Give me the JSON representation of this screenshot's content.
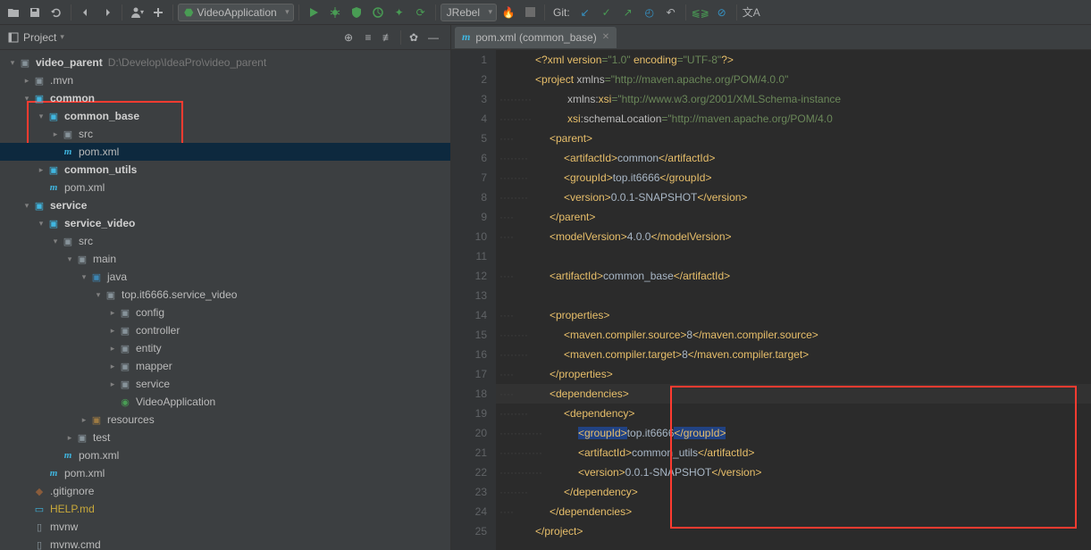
{
  "toolbar": {
    "run_config": "VideoApplication",
    "jrebel": "JRebel",
    "git_label": "Git:"
  },
  "sidebar": {
    "title": "Project",
    "root": {
      "name": "video_parent",
      "path": "D:\\Develop\\IdeaPro\\video_parent"
    },
    "items": {
      "mvn": ".mvn",
      "common": "common",
      "common_base": "common_base",
      "src1": "src",
      "pom1": "pom.xml",
      "common_utils": "common_utils",
      "pom2": "pom.xml",
      "service": "service",
      "service_video": "service_video",
      "src2": "src",
      "main": "main",
      "java": "java",
      "pkg": "top.it6666.service_video",
      "config": "config",
      "controller": "controller",
      "entity": "entity",
      "mapper": "mapper",
      "service_pkg": "service",
      "video_app": "VideoApplication",
      "resources": "resources",
      "test": "test",
      "pom3": "pom.xml",
      "pom4": "pom.xml",
      "gitignore": ".gitignore",
      "help": "HELP.md",
      "mvnw": "mvnw",
      "mvnwcmd": "mvnw.cmd"
    }
  },
  "editor": {
    "tab": "pom.xml (common_base)",
    "lines": {
      "l1a": "<?",
      "l1b": "xml version",
      "l1c": "=\"1.0\"",
      "l1d": " encoding",
      "l1e": "=\"UTF-8\"",
      "l1f": "?>",
      "l2a": "<project ",
      "l2b": "xmlns",
      "l2c": "=\"http://maven.apache.org/POM/4.0.0\"",
      "l3a": "xmlns:",
      "l3b": "xsi",
      "l3c": "=\"http://www.w3.org/2001/XMLSchema-instance",
      "l4a": "xsi",
      "l4b": ":schemaLocation",
      "l4c": "=\"http://maven.apache.org/POM/4.0",
      "l5": "<parent>",
      "l6a": "<artifactId>",
      "l6b": "common",
      "l6c": "</artifactId>",
      "l7a": "<groupId>",
      "l7b": "top.it6666",
      "l7c": "</groupId>",
      "l8a": "<version>",
      "l8b": "0.0.1-SNAPSHOT",
      "l8c": "</version>",
      "l9": "</parent>",
      "l10a": "<modelVersion>",
      "l10b": "4.0.0",
      "l10c": "</modelVersion>",
      "l12a": "<artifactId>",
      "l12b": "common_base",
      "l12c": "</artifactId>",
      "l14": "<properties>",
      "l15a": "<maven.compiler.source>",
      "l15b": "8",
      "l15c": "</maven.compiler.source>",
      "l16a": "<maven.compiler.target>",
      "l16b": "8",
      "l16c": "</maven.compiler.target>",
      "l17": "</properties>",
      "l18": "<dependencies>",
      "l19": "<dependency>",
      "l20a": "<groupId>",
      "l20b": "top.it6666",
      "l20c": "</groupId>",
      "l21a": "<artifactId>",
      "l21b": "common_utils",
      "l21c": "</artifactId>",
      "l22a": "<version>",
      "l22b": "0.0.1-SNAPSHOT",
      "l22c": "</version>",
      "l23": "</dependency>",
      "l24": "</dependencies>",
      "l25": "</project>"
    }
  }
}
